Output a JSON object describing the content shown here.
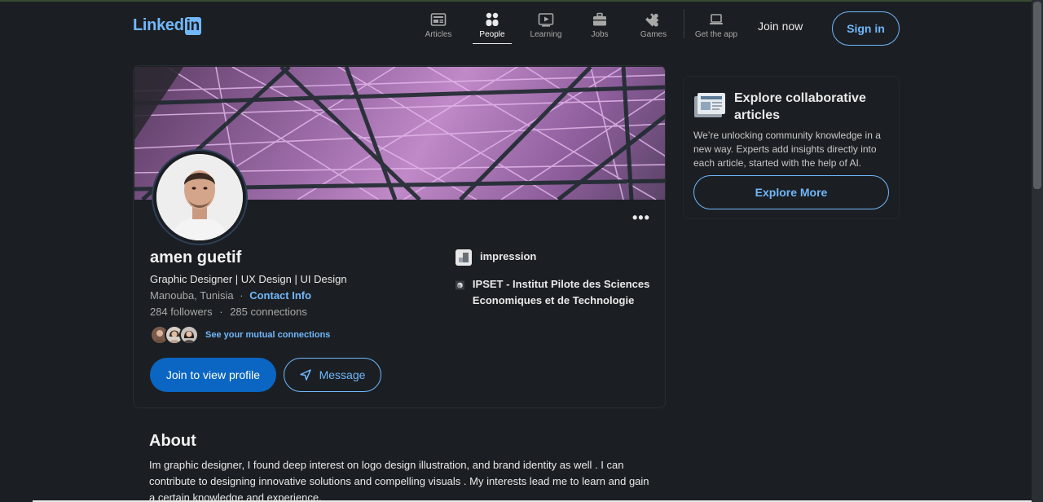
{
  "header": {
    "logo_text": "Linked",
    "logo_in": "in",
    "nav": [
      {
        "label": "Articles",
        "icon": "articles-icon"
      },
      {
        "label": "People",
        "icon": "people-icon",
        "active": true
      },
      {
        "label": "Learning",
        "icon": "learning-icon"
      },
      {
        "label": "Jobs",
        "icon": "jobs-icon"
      },
      {
        "label": "Games",
        "icon": "games-icon"
      },
      {
        "label": "Get the app",
        "icon": "laptop-icon"
      }
    ],
    "join_now": "Join now",
    "sign_in": "Sign in"
  },
  "profile": {
    "more_label": "•••",
    "name": "amen guetif",
    "headline": "Graphic Designer | UX Design | UI Design",
    "location": "Manouba, Tunisia",
    "separator": "·",
    "contact_info": "Contact Info",
    "followers": "284 followers",
    "connections": "285 connections",
    "mutual_link": "See your mutual connections",
    "join_button": "Join to view profile",
    "message_button": "Message",
    "organizations": [
      {
        "name": "impression"
      },
      {
        "name": "IPSET - Institut Pilote des Sciences Economiques et de Technologie"
      }
    ]
  },
  "about": {
    "title": "About",
    "text": "Im graphic designer, I found deep interest on logo design illustration, and brand identity as well . I can contribute to designing innovative solutions and compelling visuals . My interests lead me to learn and gain a certain knowledge and experience."
  },
  "side": {
    "title": "Explore collaborative articles",
    "text": "We’re unlocking community knowledge in a new way. Experts add insights directly into each article, started with the help of AI.",
    "button": "Explore More"
  },
  "colors": {
    "background": "#1b1f23",
    "accent": "#71b7fb",
    "primary_button": "#0a66c2"
  }
}
